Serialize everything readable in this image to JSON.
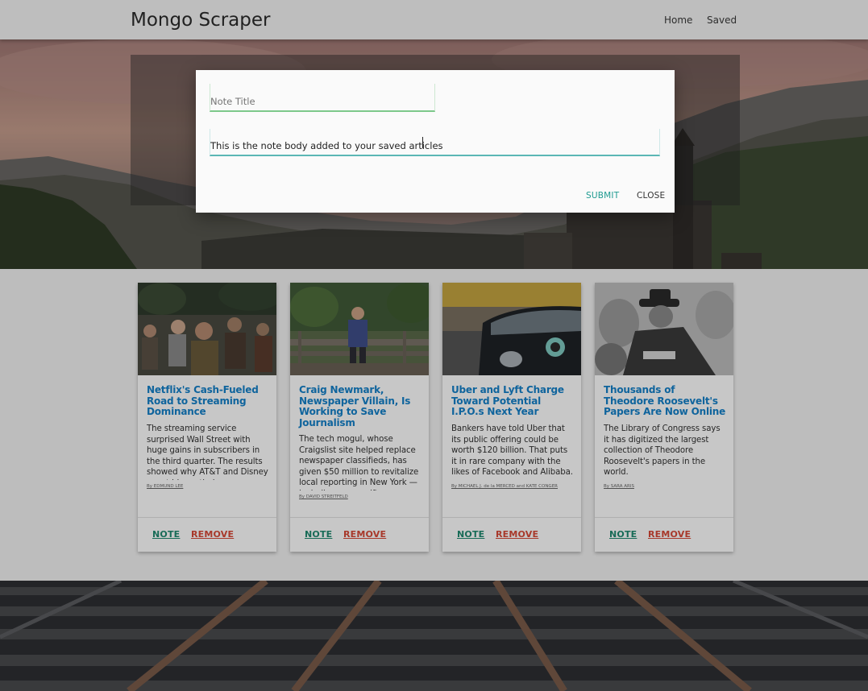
{
  "navbar": {
    "brand": "Mongo Scraper",
    "links": [
      {
        "label": "Home"
      },
      {
        "label": "Saved"
      }
    ]
  },
  "modal": {
    "title_placeholder": "Note Title",
    "title_value": "",
    "body_value": "This is the note body added to your saved articles",
    "submit_label": "SUBMIT",
    "close_label": "CLOSE"
  },
  "articles": [
    {
      "title": "Netflix's Cash-Fueled Road to Streaming Dominance",
      "summary": "The streaming service surprised Wall Street with huge gains in subscribers in the third quarter. The results showed why AT&T and Disney spent big on their",
      "byline": "By EDMUND LEE",
      "note_label": "NOTE",
      "remove_label": "REMOVE"
    },
    {
      "title": "Craig Newmark, Newspaper Villain, Is Working to Save Journalism",
      "summary": "The tech mogul, whose Craigslist site helped replace newspaper classifieds, has given $50 million to revitalize local reporting in New York — including a new gift on",
      "byline": "By DAVID STREITFELD",
      "note_label": "NOTE",
      "remove_label": "REMOVE"
    },
    {
      "title": "Uber and Lyft Charge Toward Potential I.P.O.s Next Year",
      "summary": "Bankers have told Uber that its public offering could be worth $120 billion. That puts it in rare company with the likes of Facebook and Alibaba.",
      "byline": "By MICHAEL J. de la MERCED and KATE CONGER",
      "note_label": "NOTE",
      "remove_label": "REMOVE"
    },
    {
      "title": "Thousands of Theodore Roosevelt's Papers Are Now Online",
      "summary": "The Library of Congress says it has digitized the largest collection of Theodore Roosevelt's papers in the world.",
      "byline": "By SARA ARIS",
      "note_label": "NOTE",
      "remove_label": "REMOVE"
    }
  ],
  "colors": {
    "title_link": "#1481c9",
    "note_button": "#1f8a70",
    "remove_button": "#d84a38",
    "submit_button": "#1f9b91"
  }
}
